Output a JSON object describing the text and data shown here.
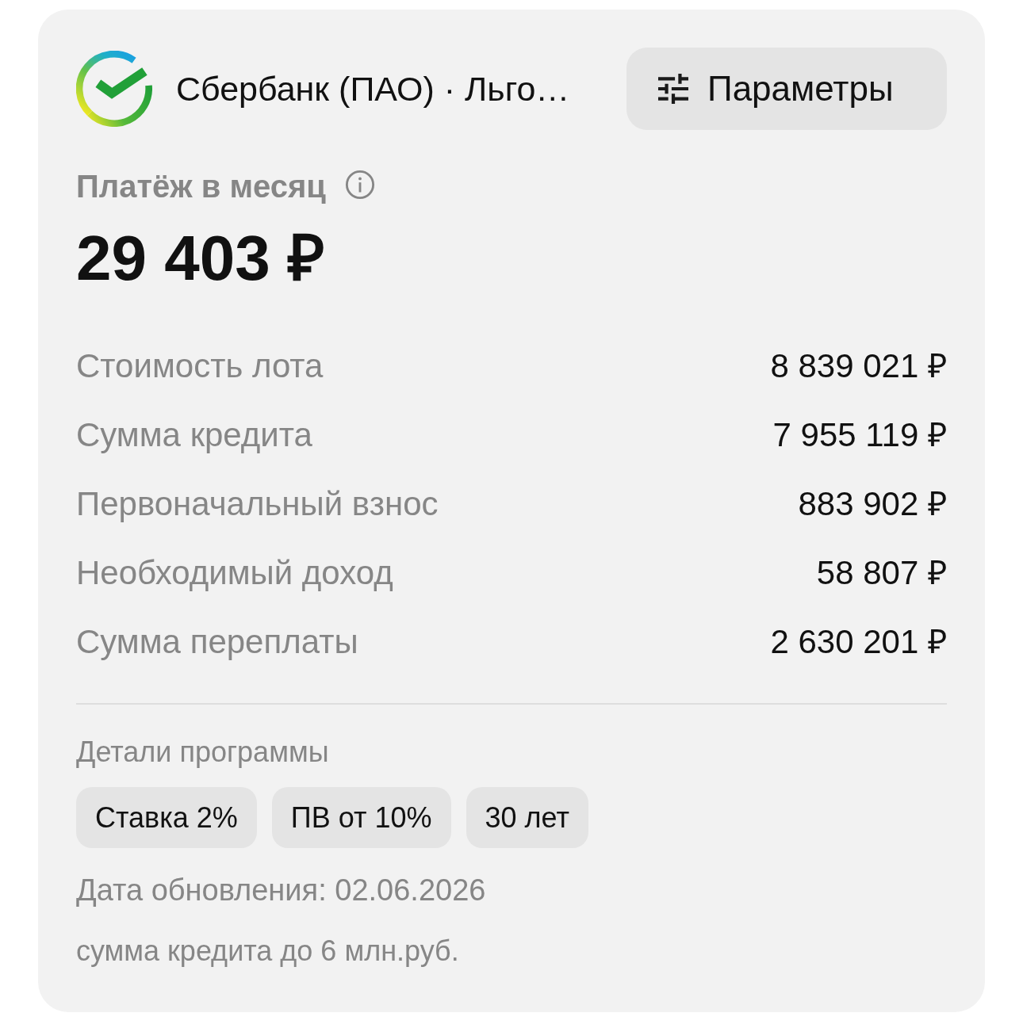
{
  "card": {
    "bank": {
      "name": "Сбербанк (ПАО) · Льго…"
    },
    "params_button": {
      "label": "Параметры"
    },
    "payment": {
      "label": "Платёж в месяц",
      "value": "29 403 ₽"
    },
    "rows": [
      {
        "label": "Стоимость лота",
        "value": "8 839 021 ₽"
      },
      {
        "label": "Сумма кредита",
        "value": "7 955 119 ₽"
      },
      {
        "label": "Первоначальный взнос",
        "value": "883 902 ₽"
      },
      {
        "label": "Необходимый доход",
        "value": "58 807 ₽"
      },
      {
        "label": "Сумма переплаты",
        "value": "2 630 201 ₽"
      }
    ],
    "details": {
      "title": "Детали программы",
      "chips": [
        "Ставка 2%",
        "ПВ от 10%",
        "30 лет"
      ]
    },
    "update_date": "Дата обновления: 02.06.2026",
    "note": "сумма кредита до 6 млн.руб."
  }
}
